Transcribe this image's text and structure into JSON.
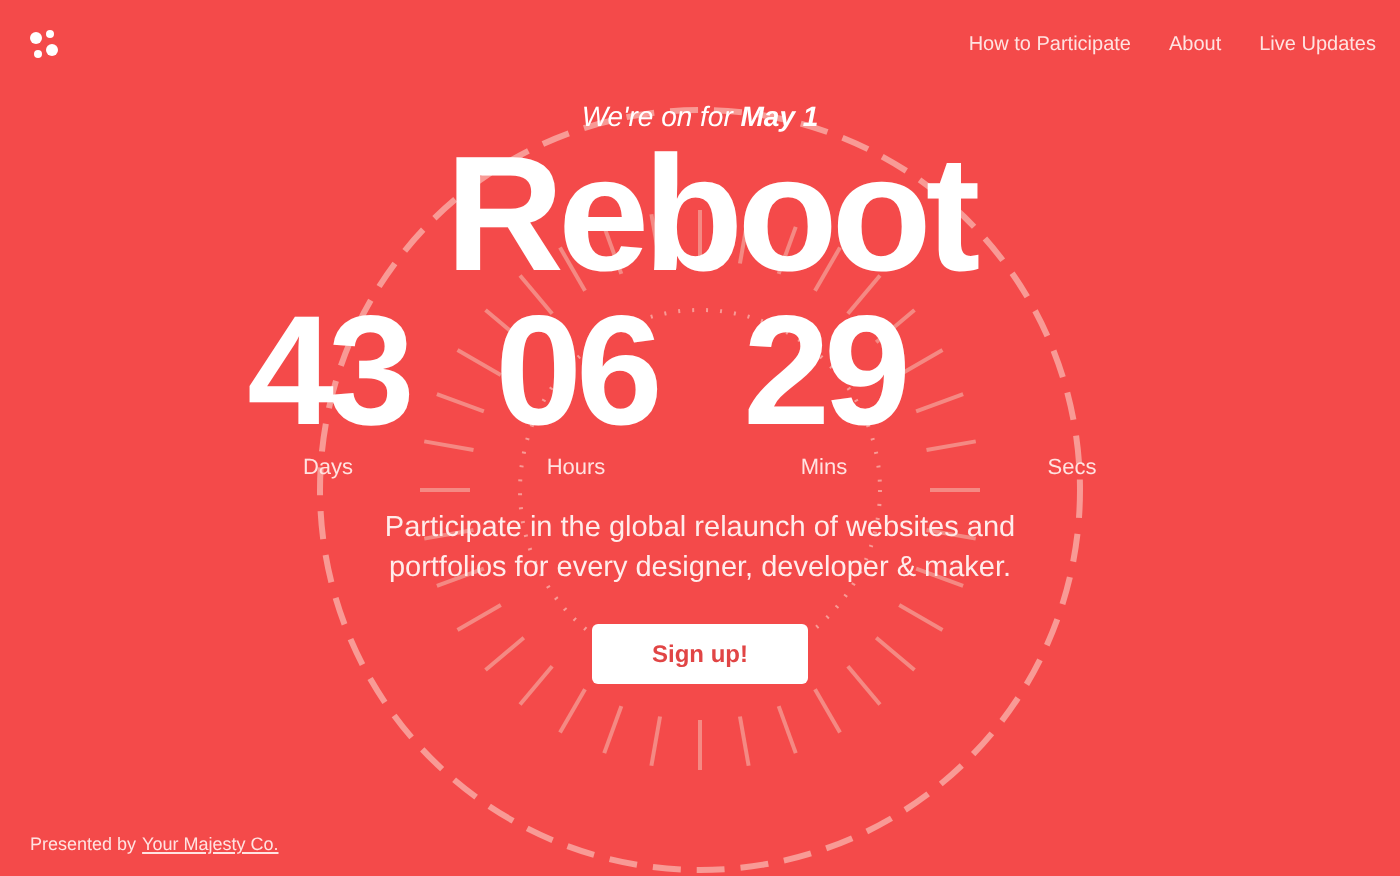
{
  "nav": {
    "links": [
      "How to Participate",
      "About",
      "Live Updates"
    ]
  },
  "tagline": "We're on for **May 1**",
  "title": "Reboot",
  "countdown": [
    {
      "value": "43",
      "label": "Days"
    },
    {
      "value": "06",
      "label": "Hours"
    },
    {
      "value": "29",
      "label": "Mins"
    },
    {
      "label": "Secs"
    }
  ],
  "description": "Participate in the global relaunch of websites and portfolios for every designer, developer & maker.",
  "cta": "Sign up!",
  "footer": {
    "text": "Presented by",
    "link": "Your Majesty Co."
  }
}
